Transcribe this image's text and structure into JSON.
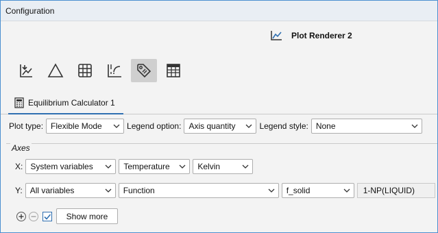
{
  "window": {
    "title": "Configuration"
  },
  "renderer": {
    "title": "Plot Renderer 2",
    "icon": "line-chart-icon"
  },
  "toolbar": {
    "tools": [
      {
        "icon": "chart-export-icon"
      },
      {
        "icon": "triangle-icon"
      },
      {
        "icon": "grid-icon"
      },
      {
        "icon": "curve-axis-icon"
      },
      {
        "icon": "tag-icon",
        "active": true
      },
      {
        "icon": "table-icon"
      }
    ]
  },
  "tab": {
    "label": "Equilibrium Calculator 1",
    "icon": "calculator-icon"
  },
  "options": {
    "plot_type_label": "Plot type:",
    "plot_type_value": "Flexible Mode",
    "legend_option_label": "Legend option:",
    "legend_option_value": "Axis quantity",
    "legend_style_label": "Legend style:",
    "legend_style_value": "None"
  },
  "axes": {
    "title": "Axes",
    "x": {
      "label": "X:",
      "variable_type": "System variables",
      "quantity": "Temperature",
      "unit": "Kelvin"
    },
    "y": {
      "label": "Y:",
      "variable_type": "All variables",
      "quantity": "Function",
      "function": "f_solid",
      "expression": "1-NP(LIQUID)"
    }
  },
  "controls": {
    "show_more_label": "Show more",
    "checkbox_checked": true
  }
}
